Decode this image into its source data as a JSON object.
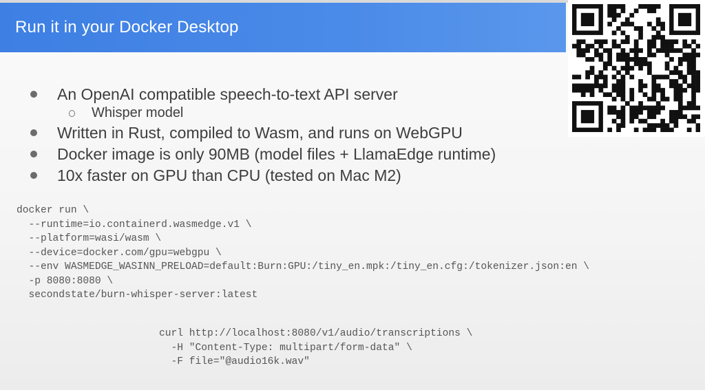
{
  "slide": {
    "title": "Run it in your Docker Desktop",
    "bullets": [
      {
        "text": "An OpenAI compatible speech-to-text API server",
        "level": 1
      },
      {
        "text": "Whisper model",
        "level": 2
      },
      {
        "text": "Written in Rust, compiled to Wasm, and runs on WebGPU",
        "level": 1
      },
      {
        "text": "Docker image is only 90MB (model files + LlamaEdge runtime)",
        "level": 1
      },
      {
        "text": "10x faster on GPU than CPU (tested on Mac M2)",
        "level": 1
      }
    ],
    "docker_command": [
      "docker run \\",
      "  --runtime=io.containerd.wasmedge.v1 \\",
      "  --platform=wasi/wasm \\",
      "  --device=docker.com/gpu=webgpu \\",
      "  --env WASMEDGE_WASINN_PRELOAD=default:Burn:GPU:/tiny_en.mpk:/tiny_en.cfg:/tokenizer.json:en \\",
      "  -p 8080:8080 \\",
      "  secondstate/burn-whisper-server:latest"
    ],
    "curl_command": [
      "curl http://localhost:8080/v1/audio/transcriptions \\",
      "  -H \"Content-Type: multipart/form-data\" \\",
      "  -F file=\"@audio16k.wav\""
    ],
    "qr_icon": "qr-code-icon",
    "colors": {
      "header": "#4285f4",
      "text": "#3e3e3e",
      "code": "#555555"
    }
  }
}
